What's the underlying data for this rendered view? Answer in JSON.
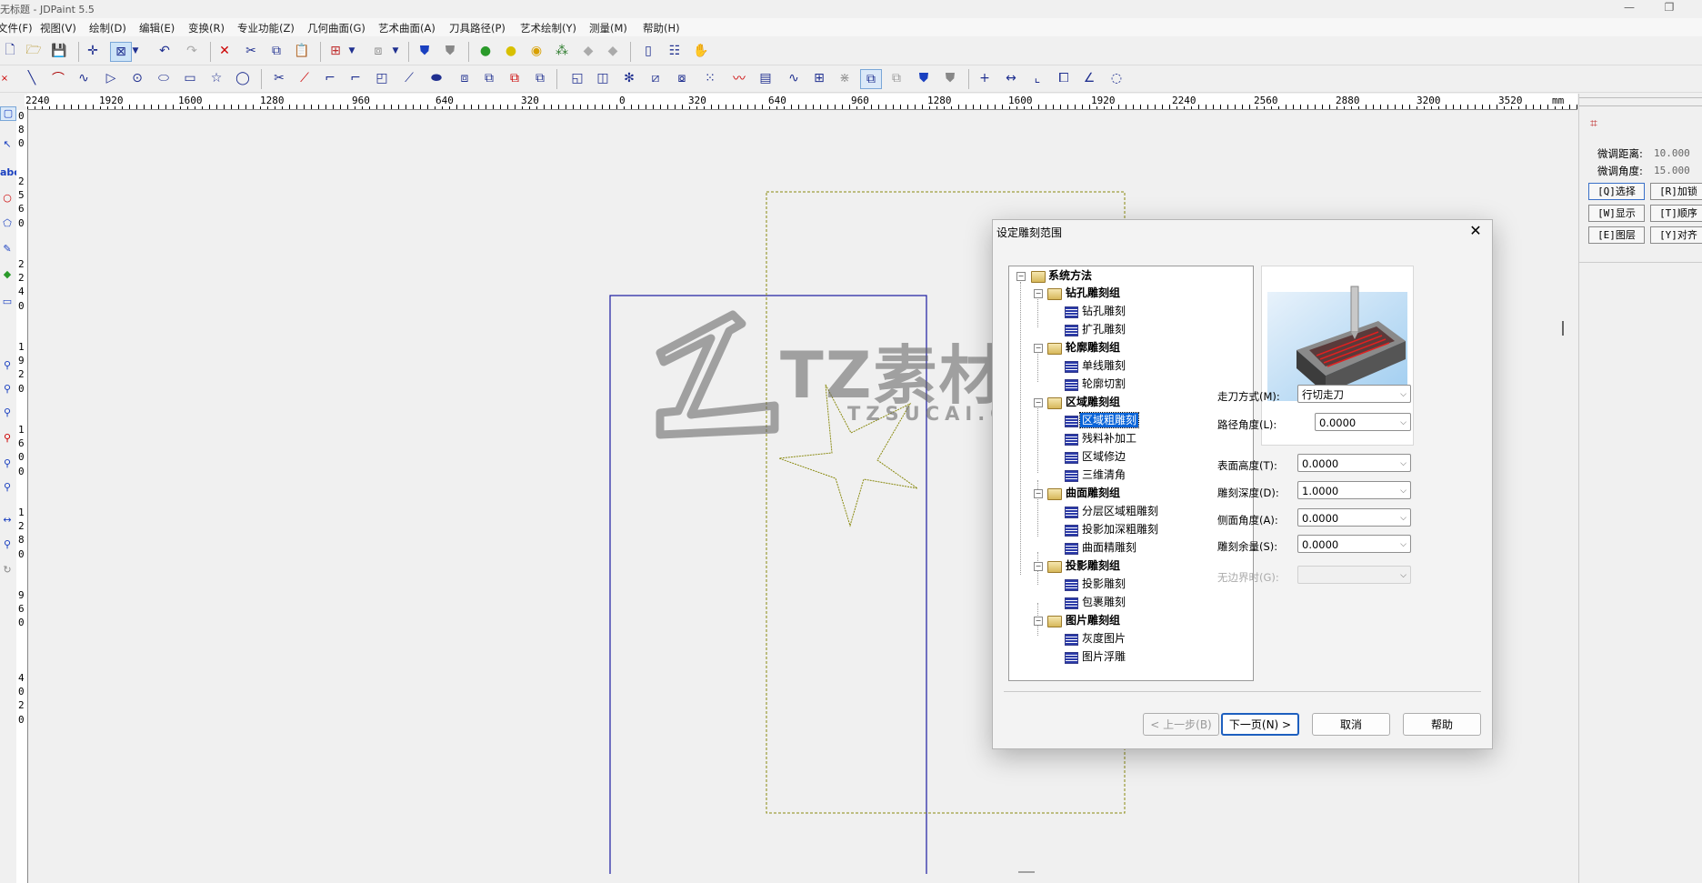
{
  "window": {
    "title": "无标题 - JDPaint 5.5"
  },
  "menu": [
    "文件(F)",
    "视图(V)",
    "绘制(D)",
    "编辑(E)",
    "变换(R)",
    "专业功能(Z)",
    "几何曲面(G)",
    "艺术曲面(A)",
    "刀具路径(P)",
    "艺术绘制(Y)",
    "测量(M)",
    "帮助(H)"
  ],
  "ruler": {
    "unit": "mm",
    "labels": [
      "2240",
      "1920",
      "1600",
      "1280",
      "960",
      "640",
      "320",
      "0",
      "320",
      "640",
      "960",
      "1280",
      "1600",
      "1920",
      "2240",
      "2560",
      "2880",
      "3200",
      "3520"
    ]
  },
  "vruler": {
    "labels": [
      "0",
      "8",
      "0",
      "2",
      "5",
      "6",
      "0",
      "2",
      "2",
      "4",
      "0",
      "1",
      "9",
      "2",
      "0",
      "1",
      "6",
      "0",
      "0",
      "1",
      "2",
      "8",
      "0",
      "9",
      "6",
      "0",
      "4",
      "0",
      "2",
      "0"
    ]
  },
  "right_panel": {
    "fine_distance_label": "微调距离:",
    "fine_distance_value": "10.000",
    "fine_angle_label": "微调角度:",
    "fine_angle_value": "15.000",
    "buttons": [
      "[Q]选择",
      "[R]加锁",
      "[W]显示",
      "[T]顺序",
      "[E]图层",
      "[Y]对齐"
    ]
  },
  "dialog": {
    "title": "设定雕刻范围",
    "tree": {
      "root": "系统方法",
      "groups": [
        {
          "label": "钻孔雕刻组",
          "items": [
            "钻孔雕刻",
            "扩孔雕刻"
          ]
        },
        {
          "label": "轮廓雕刻组",
          "items": [
            "单线雕刻",
            "轮廓切割"
          ]
        },
        {
          "label": "区域雕刻组",
          "items": [
            "区域粗雕刻",
            "残料补加工",
            "区域修边",
            "三维清角"
          ]
        },
        {
          "label": "曲面雕刻组",
          "items": [
            "分层区域粗雕刻",
            "投影加深粗雕刻",
            "曲面精雕刻"
          ]
        },
        {
          "label": "投影雕刻组",
          "items": [
            "投影雕刻",
            "包裹雕刻"
          ]
        },
        {
          "label": "图片雕刻组",
          "items": [
            "灰度图片",
            "图片浮雕"
          ]
        }
      ],
      "selected": "区域粗雕刻"
    },
    "fields": {
      "toolpath_mode_label": "走刀方式(M):",
      "toolpath_mode_value": "行切走刀",
      "path_angle_label": "路径角度(L):",
      "path_angle_value": "0.0000",
      "surface_height_label": "表面高度(T):",
      "surface_height_value": "0.0000",
      "engrave_depth_label": "雕刻深度(D):",
      "engrave_depth_value": "1.0000",
      "side_angle_label": "侧面角度(A):",
      "side_angle_value": "0.0000",
      "engrave_allowance_label": "雕刻余量(S):",
      "engrave_allowance_value": "0.0000",
      "no_boundary_label": "无边界时(G):",
      "no_boundary_value": ""
    },
    "buttons": {
      "prev": "< 上一步(B)",
      "next": "下一页(N) >",
      "cancel": "取消",
      "help": "帮助"
    }
  },
  "watermark": {
    "brand": "TZ素材网",
    "url": "TZSUCAI.COM"
  },
  "colors": {
    "accent": "#0a64d8",
    "shape_blue": "#1a1aa0",
    "shape_olive": "#8a8a10"
  }
}
